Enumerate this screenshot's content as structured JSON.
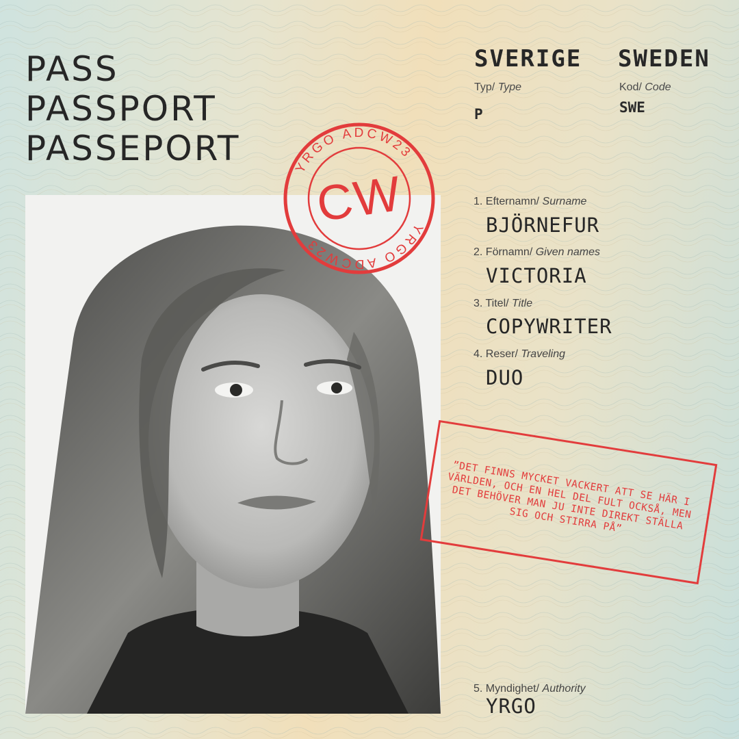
{
  "header": {
    "title_lines": [
      "PASS",
      "PASSPORT",
      "PASSEPORT"
    ],
    "country_sv": "SVERIGE",
    "country_en": "SWEDEN",
    "type_label_sv": "Typ/",
    "type_label_en": "Type",
    "type_value": "P",
    "code_label_sv": "Kod/",
    "code_label_en": "Code",
    "code_value": "SWE"
  },
  "stamp": {
    "ring_text": "YRGO ADCW23",
    "center": "CW",
    "color": "#e23c3c"
  },
  "fields": [
    {
      "num": "1.",
      "label_sv": "Efternamn/",
      "label_en": "Surname",
      "value": "BJÖRNEFUR"
    },
    {
      "num": "2.",
      "label_sv": "Förnamn/",
      "label_en": "Given names",
      "value": "VICTORIA"
    },
    {
      "num": "3.",
      "label_sv": "Titel/",
      "label_en": "Title",
      "value": "COPYWRITER"
    },
    {
      "num": "4.",
      "label_sv": "Reser/",
      "label_en": "Traveling",
      "value": "DUO"
    },
    {
      "num": "5.",
      "label_sv": "Myndighet/",
      "label_en": "Authority",
      "value": "YRGO"
    }
  ],
  "quote": "”DET FINNS MYCKET VACKERT ATT SE HÄR I VÄRLDEN, OCH EN HEL DEL FULT OCKSÅ, MEN DET BEHÖVER MAN JU INTE DIREKT STÄLLA SIG OCH STIRRA PÅ”",
  "photo": {
    "icon": "portrait-photo"
  }
}
